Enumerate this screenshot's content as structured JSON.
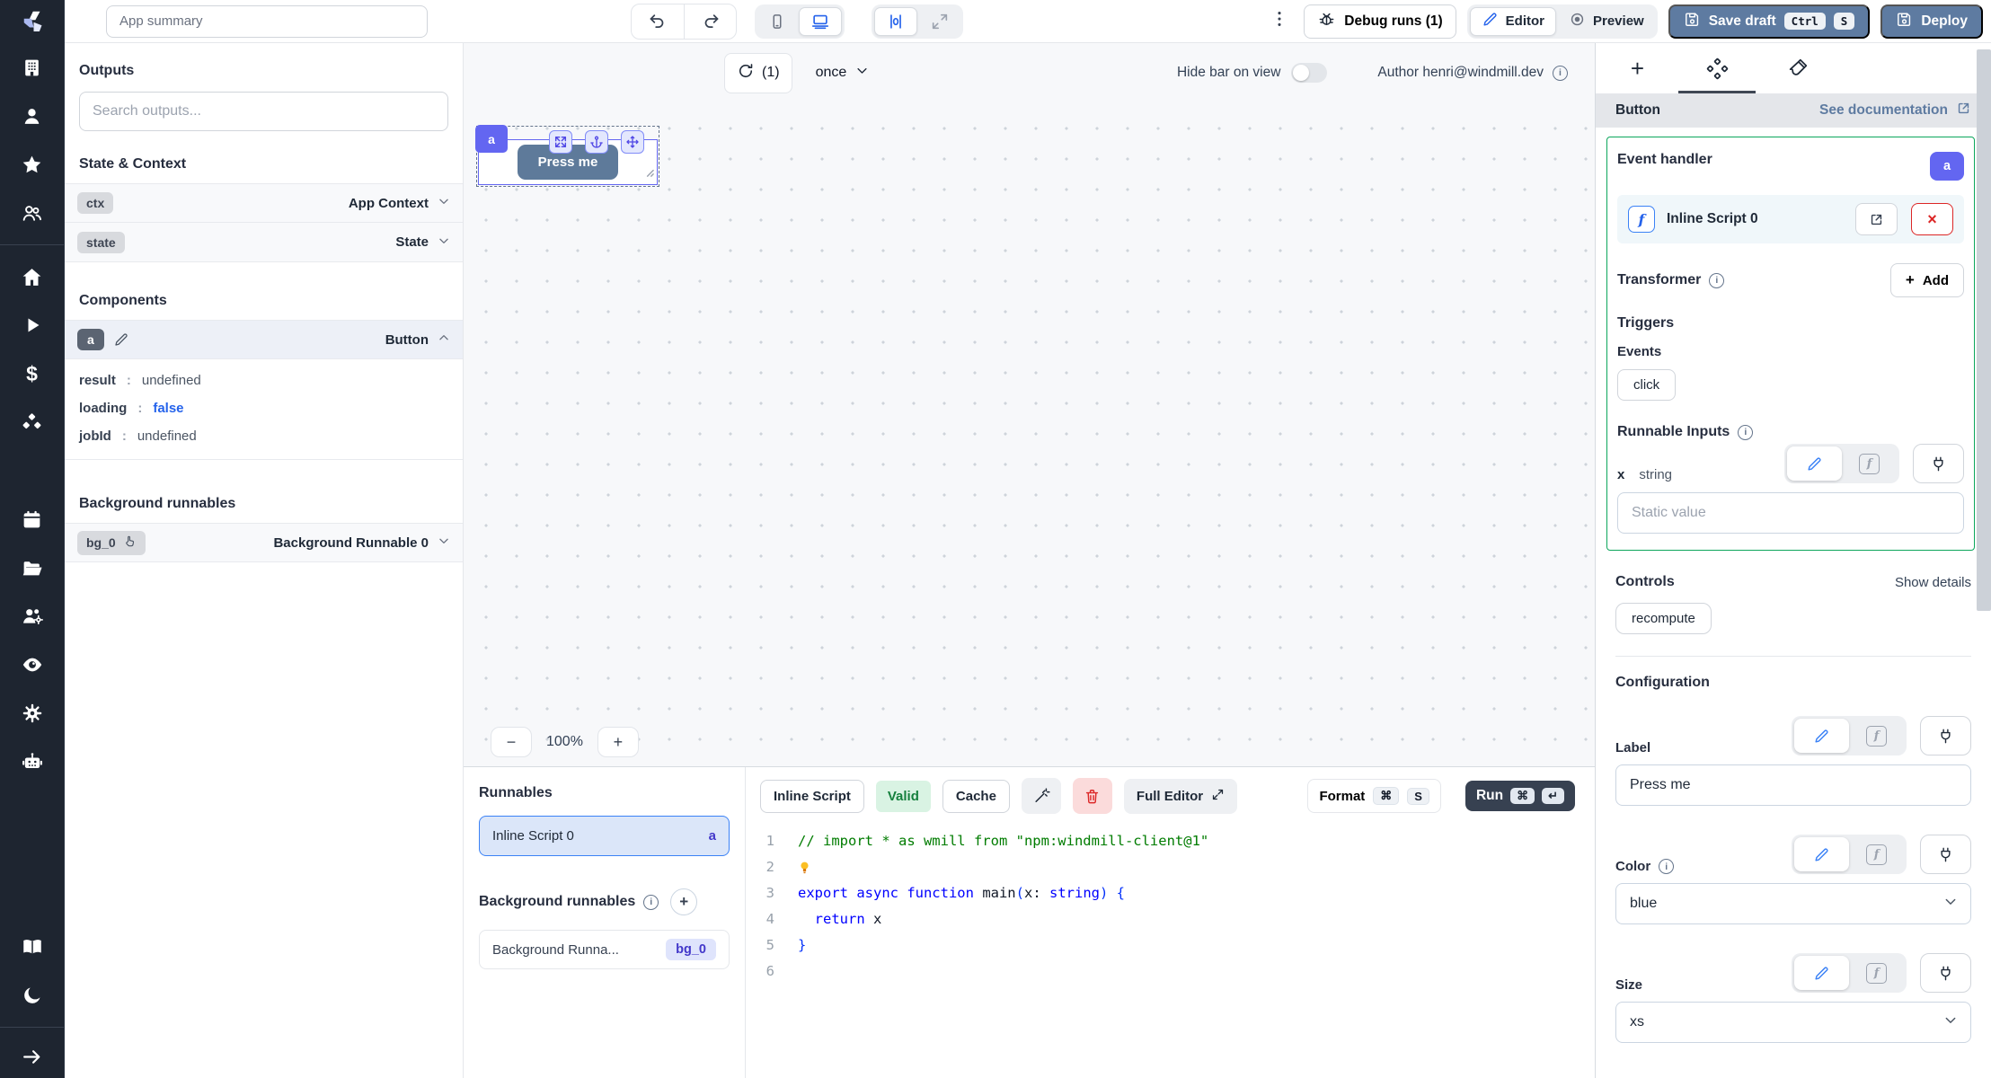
{
  "colors": {
    "accent_indigo": "#6366f1",
    "frost_blue": "#5e7ba1",
    "valid_green": "#15803d",
    "outline_green": "#0ca65c",
    "link_blue": "#2563eb",
    "danger_red": "#dc2626",
    "rail_bg": "#1e2530"
  },
  "sidebar": {
    "icons": [
      "windmill-logo",
      "building",
      "user",
      "star",
      "users",
      "home",
      "play",
      "dollar",
      "boxes",
      "calendar",
      "folder",
      "users-gear",
      "eye",
      "gear",
      "robot",
      "book",
      "moon",
      "arrow-right"
    ]
  },
  "topbar": {
    "app_summary_placeholder": "App summary",
    "debug_runs": "Debug runs (1)",
    "editor": "Editor",
    "preview": "Preview",
    "save_draft": "Save draft",
    "save_kbd": [
      "Ctrl",
      "S"
    ],
    "deploy": "Deploy"
  },
  "outputs": {
    "title": "Outputs",
    "search_placeholder": "Search outputs...",
    "state_context_title": "State & Context",
    "ctx_id": "ctx",
    "ctx_label": "App Context",
    "state_id": "state",
    "state_label": "State",
    "components_title": "Components",
    "component_id": "a",
    "component_type": "Button",
    "props": [
      {
        "key": "result",
        "value": "undefined"
      },
      {
        "key": "loading",
        "value": "false"
      },
      {
        "key": "jobId",
        "value": "undefined"
      }
    ],
    "background_title": "Background runnables",
    "bg_id": "bg_0",
    "bg_label": "Background Runnable 0"
  },
  "canvas": {
    "refresh_count": "(1)",
    "schedule": "once",
    "hide_bar": "Hide bar on view",
    "author": "Author henri@windmill.dev",
    "zoom_out": "−",
    "zoom_level": "100%",
    "zoom_in": "+",
    "component_tag": "a",
    "button_label": "Press me"
  },
  "runnables": {
    "title": "Runnables",
    "inline_label": "Inline Script 0",
    "inline_badge": "a",
    "background_title": "Background runnables",
    "bg_item_label": "Background Runna...",
    "bg_item_badge": "bg_0"
  },
  "editor": {
    "tab": "Inline Script",
    "valid": "Valid",
    "cache": "Cache",
    "full_editor": "Full Editor",
    "format": "Format",
    "format_keys": [
      "⌘",
      "S"
    ],
    "run": "Run",
    "run_keys": [
      "⌘",
      "↵"
    ],
    "code_lines": [
      {
        "n": "1",
        "tokens": [
          {
            "c": "comment",
            "t": "// import * as wmill from \"npm:windmill-client@1\""
          }
        ]
      },
      {
        "n": "2",
        "tokens": [
          {
            "c": "bulb",
            "t": ""
          }
        ]
      },
      {
        "n": "3",
        "tokens": [
          {
            "c": "kw",
            "t": "export async function "
          },
          {
            "c": "plain",
            "t": "main"
          },
          {
            "c": "br",
            "t": "("
          },
          {
            "c": "plain",
            "t": "x"
          },
          {
            "c": "plain",
            "t": ": "
          },
          {
            "c": "kw",
            "t": "string"
          },
          {
            "c": "br",
            "t": ") {"
          }
        ]
      },
      {
        "n": "4",
        "tokens": [
          {
            "c": "plain",
            "t": "  "
          },
          {
            "c": "kw",
            "t": "return"
          },
          {
            "c": "plain",
            "t": " x"
          }
        ]
      },
      {
        "n": "5",
        "tokens": [
          {
            "c": "br",
            "t": "}"
          }
        ]
      },
      {
        "n": "6",
        "tokens": []
      }
    ]
  },
  "inspector": {
    "component_type": "Button",
    "doc_link": "See documentation",
    "event_handler_title": "Event handler",
    "event_badge": "a",
    "script_name": "Inline Script 0",
    "transformer_title": "Transformer",
    "add_label": "Add",
    "triggers_title": "Triggers",
    "events_label": "Events",
    "event_chip": "click",
    "runnable_inputs_title": "Runnable Inputs",
    "input_key": "x",
    "input_type": "string",
    "input_placeholder": "Static value",
    "controls_title": "Controls",
    "show_details": "Show details",
    "control_chip": "recompute",
    "configuration_title": "Configuration",
    "label_field": "Label",
    "label_value": "Press me",
    "color_field": "Color",
    "color_value": "blue",
    "size_field": "Size",
    "size_value": "xs"
  }
}
